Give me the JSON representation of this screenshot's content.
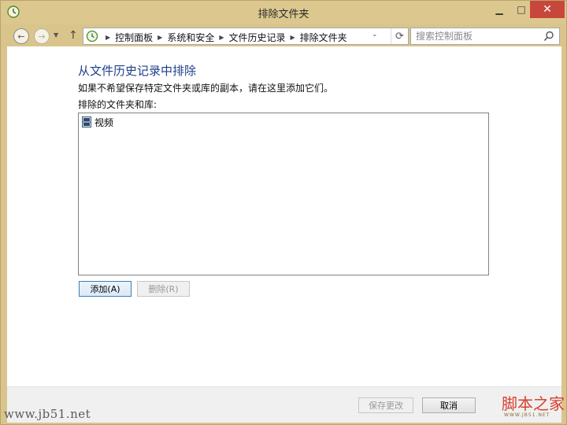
{
  "window": {
    "title": "排除文件夹",
    "minimize_glyph": "▁",
    "maximize_glyph": "□",
    "close_glyph": "✕"
  },
  "nav": {
    "back_glyph": "←",
    "forward_glyph": "→",
    "dropdown_glyph": "▼",
    "up_glyph": "↑",
    "breadcrumbs": [
      "控制面板",
      "系统和安全",
      "文件历史记录",
      "排除文件夹"
    ],
    "crumb_sep": "▶",
    "addr_dropdown_glyph": "⌄",
    "refresh_glyph": "⟳",
    "search_placeholder": "搜索控制面板"
  },
  "main": {
    "title": "从文件历史记录中排除",
    "description": "如果不希望保存特定文件夹或库的副本，请在这里添加它们。",
    "list_label": "排除的文件夹和库:",
    "items": [
      {
        "label": "视频",
        "icon": "video-library-icon"
      }
    ],
    "add_label": "添加(A)",
    "remove_label": "删除(R)"
  },
  "footer": {
    "save_label": "保存更改",
    "cancel_label": "取消"
  },
  "watermarks": {
    "left": "www.jb51.net",
    "right": "脚本之家",
    "right_sub": "WWW.JB51.NET"
  },
  "colors": {
    "frame": "#d9c58b",
    "title_blue": "#1e3f8a",
    "close": "#c7473c"
  }
}
